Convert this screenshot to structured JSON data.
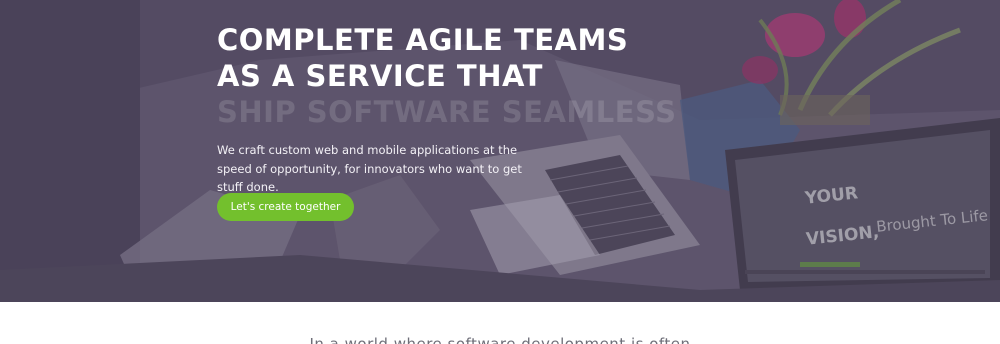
{
  "hero": {
    "title_line_1": "COMPLETE AGILE TEAMS",
    "title_line_2": "AS A SERVICE THAT",
    "title_line_3_faded": "SHIP SOFTWARE SEAMLESSLY",
    "description": "We craft custom web and mobile applications at the speed of opportunity, for innovators who want to get stuff done.",
    "cta_label": "Let's create together",
    "screen_text_your": "YOUR",
    "screen_text_vision": "VISION,",
    "screen_text_tagline": "Brought To Life",
    "colors": {
      "overlay": "#574f66",
      "cta": "#73c02d",
      "text": "#ffffff"
    }
  },
  "intro": {
    "text": "In a world where software development is often"
  }
}
